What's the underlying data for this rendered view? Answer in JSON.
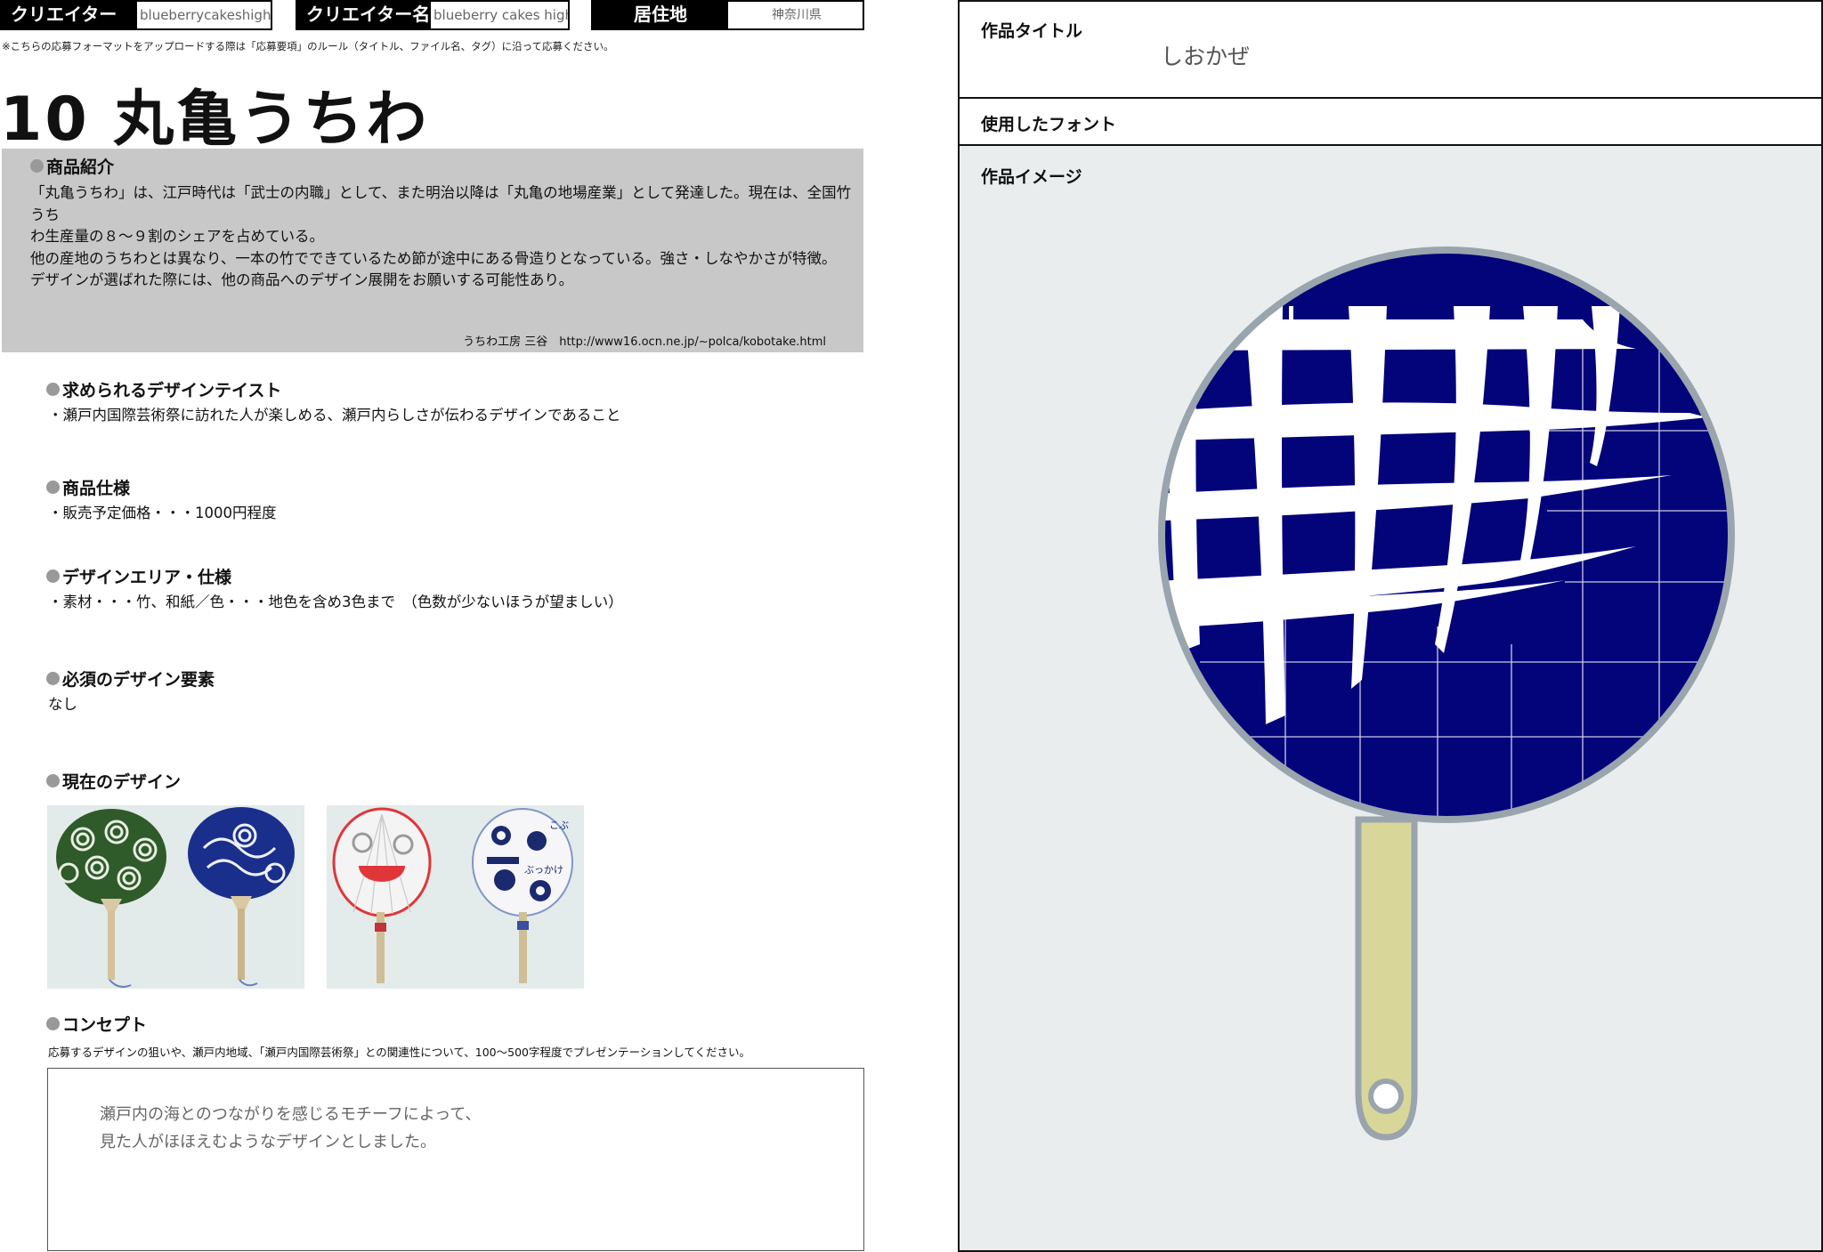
{
  "header": {
    "creator_id_label": "クリエイターID",
    "creator_id_value": "blueberrycakeshigh",
    "creator_name_label": "クリエイター名",
    "creator_name_value": "blueberry cakes high",
    "residence_label": "居住地",
    "residence_value": "神奈川県",
    "note": "※こちらの応募フォーマットをアップロードする際は「応募要項」のルール（タイトル、ファイル名、タグ）に沿って応募ください。"
  },
  "title": "10 丸亀うちわ",
  "intro": {
    "heading": "商品紹介",
    "lines": [
      "「丸亀うちわ」は、江戸時代は「武士の内職」として、また明治以降は「丸亀の地場産業」として発達した。現在は、全国竹うち",
      "わ生産量の８～９割のシェアを占めている。",
      "他の産地のうちわとは異なり、一本の竹でできているため節が途中にある骨造りとなっている。強さ・しなやかさが特徴。",
      "デザインが選ばれた際には、他の商品へのデザイン展開をお願いする可能性あり。"
    ],
    "credit": "うちわ工房 三谷　http://www16.ocn.ne.jp/~polca/kobotake.html"
  },
  "sections": {
    "taste_heading": "求められるデザインテイスト",
    "taste_text": "・瀬戸内国際芸術祭に訪れた人が楽しめる、瀬戸内らしさが伝わるデザインであること",
    "spec_heading": "商品仕様",
    "spec_text": "・販売予定価格・・・1000円程度",
    "area_heading": "デザインエリア・仕様",
    "area_text": "・素材・・・竹、和紙／色・・・地色を含め3色まで　（色数が少ないほうが望ましい）",
    "required_heading": "必須のデザイン要素",
    "required_text": "なし",
    "current_heading": "現在のデザイン",
    "concept_heading": "コンセプト",
    "concept_note": "応募するデザインの狙いや、瀬戸内地域、「瀬戸内国際芸術祭」との関連性について、100〜500字程度でプレゼンテーションしてください。",
    "concept_text_1": "瀬戸内の海とのつながりを感じるモチーフによって、",
    "concept_text_2": "見た人がほほえむようなデザインとしました。"
  },
  "photo_right": {
    "kanji_a": "こぶ",
    "kanji_b": "ぶっかけ"
  },
  "panel": {
    "work_title_label": "作品タイトル",
    "work_title_value": "しおかぜ",
    "font_label": "使用したフォント",
    "image_label": "作品イメージ"
  },
  "colors": {
    "fan_navy": "#03037a",
    "handle": "#d9d69a",
    "fan_border": "#9aa4ac",
    "panel_bg": "#e9eded"
  }
}
